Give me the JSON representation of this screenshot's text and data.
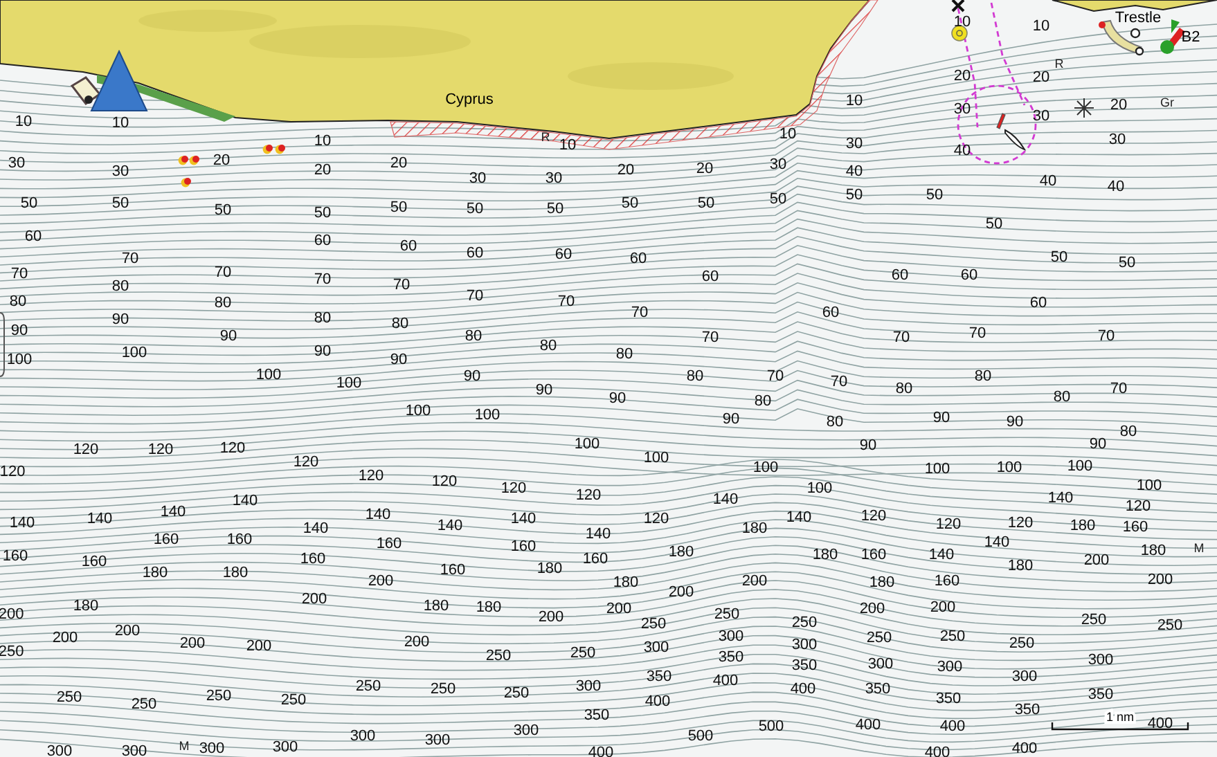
{
  "chart_labels": [
    {
      "text": "Cyprus",
      "kind": "place"
    },
    {
      "text": "Trestle",
      "kind": "place"
    },
    {
      "text": "B2",
      "kind": "place"
    },
    {
      "text": "R",
      "kind": "mark"
    },
    {
      "text": "R",
      "kind": "mark"
    },
    {
      "text": "Gr",
      "kind": "mark"
    },
    {
      "text": "M",
      "kind": "mark"
    },
    {
      "text": "M",
      "kind": "mark"
    }
  ],
  "depth_labels": [
    "10",
    "10",
    "10",
    "10",
    "10",
    "10",
    "10",
    "10",
    "20",
    "20",
    "20",
    "20",
    "20",
    "20",
    "20",
    "20",
    "30",
    "30",
    "30",
    "30",
    "30",
    "30",
    "30",
    "30",
    "30",
    "40",
    "40",
    "40",
    "40",
    "50",
    "50",
    "50",
    "50",
    "50",
    "50",
    "50",
    "50",
    "50",
    "50",
    "50",
    "50",
    "50",
    "50",
    "50",
    "60",
    "60",
    "60",
    "60",
    "60",
    "60",
    "60",
    "60",
    "60",
    "60",
    "60",
    "70",
    "70",
    "70",
    "70",
    "70",
    "70",
    "70",
    "70",
    "70",
    "70",
    "70",
    "70",
    "70",
    "70",
    "70",
    "80",
    "80",
    "80",
    "80",
    "80",
    "80",
    "80",
    "80",
    "80",
    "80",
    "80",
    "80",
    "80",
    "80",
    "80",
    "90",
    "90",
    "90",
    "90",
    "90",
    "90",
    "90",
    "90",
    "90",
    "90",
    "90",
    "90",
    "90",
    "100",
    "100",
    "100",
    "100",
    "100",
    "100",
    "100",
    "100",
    "100",
    "100",
    "100",
    "100",
    "100",
    "100",
    "120",
    "120",
    "120",
    "120",
    "120",
    "120",
    "120",
    "120",
    "120",
    "120",
    "120",
    "120",
    "120",
    "120",
    "140",
    "140",
    "140",
    "140",
    "140",
    "140",
    "140",
    "140",
    "140",
    "140",
    "140",
    "140",
    "140",
    "140",
    "160",
    "160",
    "160",
    "160",
    "160",
    "160",
    "160",
    "160",
    "160",
    "160",
    "160",
    "160",
    "180",
    "180",
    "180",
    "180",
    "180",
    "180",
    "180",
    "180",
    "180",
    "180",
    "180",
    "180",
    "180",
    "180",
    "200",
    "200",
    "200",
    "200",
    "200",
    "200",
    "200",
    "200",
    "200",
    "200",
    "200",
    "200",
    "200",
    "200",
    "200",
    "200",
    "250",
    "250",
    "250",
    "250",
    "250",
    "250",
    "250",
    "250",
    "250",
    "250",
    "250",
    "250",
    "250",
    "250",
    "250",
    "250",
    "250",
    "250",
    "300",
    "300",
    "300",
    "300",
    "300",
    "300",
    "300",
    "300",
    "300",
    "300",
    "300",
    "300",
    "300",
    "300",
    "300",
    "350",
    "350",
    "350",
    "350",
    "350",
    "350",
    "350",
    "350",
    "400",
    "400",
    "400",
    "400",
    "400",
    "400",
    "400",
    "400",
    "400",
    "500",
    "500"
  ],
  "scale_bar": {
    "label": "1 nm"
  }
}
